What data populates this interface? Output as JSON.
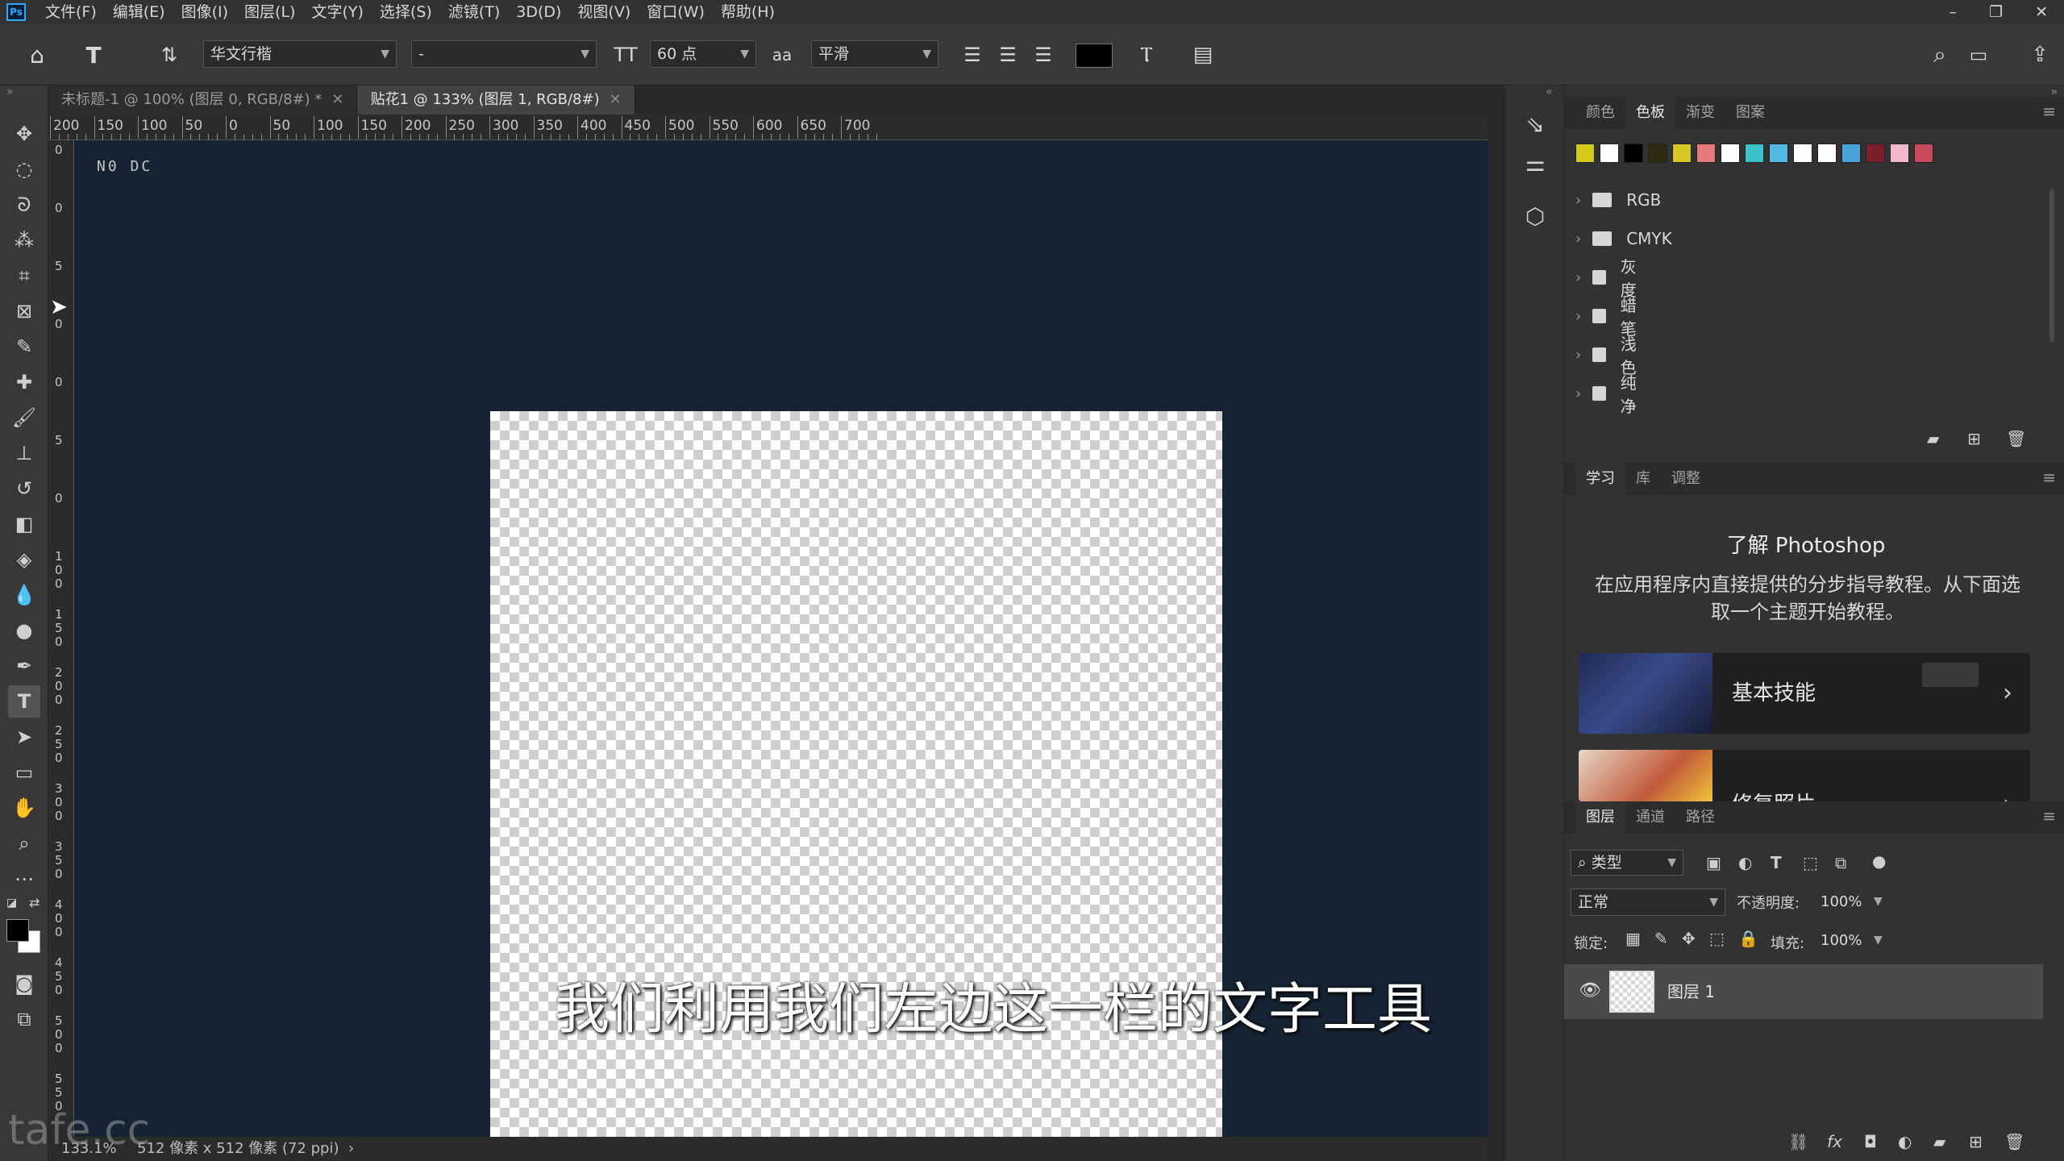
{
  "app": {
    "logo": "Ps"
  },
  "menu": [
    "文件(F)",
    "编辑(E)",
    "图像(I)",
    "图层(L)",
    "文字(Y)",
    "选择(S)",
    "滤镜(T)",
    "3D(D)",
    "视图(V)",
    "窗口(W)",
    "帮助(H)"
  ],
  "window_controls": {
    "minimize": "–",
    "restore": "❐",
    "close": "✕"
  },
  "options": {
    "font_family": "华文行楷",
    "font_style": "-",
    "font_size": "60 点",
    "antialias": "平滑",
    "text_color": "#000000"
  },
  "document_tabs": [
    {
      "title": "未标题-1 @ 100% (图层 0, RGB/8#) *",
      "active": false
    },
    {
      "title": "贴花1 @ 133% (图层 1, RGB/8#)",
      "active": true
    }
  ],
  "ruler": {
    "horizontal": [
      "200",
      "150",
      "100",
      "50",
      "0",
      "50",
      "100",
      "150",
      "200",
      "250",
      "300",
      "350",
      "400",
      "450",
      "500",
      "550",
      "600",
      "650",
      "700"
    ],
    "vertical": [
      "0",
      "0",
      "5",
      "0",
      "0",
      "5",
      "0",
      "1\n0\n0",
      "1\n5\n0",
      "2\n0\n0",
      "2\n5\n0",
      "3\n0\n0",
      "3\n5\n0",
      "4\n0\n0",
      "4\n5\n0",
      "5\n0\n0",
      "5\n5\n0"
    ]
  },
  "canvas_corner_text": "N0 DC",
  "status": {
    "zoom": "133.1%",
    "doc_info": "512 像素 x 512 像素 (72 ppi)",
    "arrow": "›"
  },
  "swatch_panel": {
    "tabs": [
      "颜色",
      "色板",
      "渐变",
      "图案"
    ],
    "active_tab": "色板",
    "swatches": [
      "#d5cc1a",
      "#ffffff",
      "#000000",
      "#2e2a10",
      "#d8c526",
      "#e57c7c",
      "#ffffff",
      "#38c3c9",
      "#52b8e6",
      "#ffffff",
      "#ffffff",
      "#4aa3d6",
      "#7a1e2a",
      "#f0b8c8",
      "#c9485c"
    ],
    "groups": [
      "RGB",
      "CMYK",
      "灰度",
      "蜡笔",
      "浅色",
      "纯净"
    ]
  },
  "learn_panel": {
    "tabs": [
      "学习",
      "库",
      "调整"
    ],
    "active_tab": "学习",
    "heading": "了解 Photoshop",
    "description": "在应用程序内直接提供的分步指导教程。从下面选取一个主题开始教程。",
    "cards": [
      {
        "title": "基本技能"
      },
      {
        "title": "修复照片"
      }
    ]
  },
  "layers_panel": {
    "tabs": [
      "图层",
      "通道",
      "路径"
    ],
    "active_tab": "图层",
    "filter_label": "类型",
    "blend_mode": "正常",
    "opacity_label": "不透明度:",
    "opacity": "100%",
    "lock_label": "锁定:",
    "fill_label": "填充:",
    "fill": "100%",
    "layers": [
      {
        "name": "图层 1",
        "visible": true
      }
    ]
  },
  "subtitle": "我们利用我们左边这一栏的文字工具",
  "watermark": "tafe.cc"
}
